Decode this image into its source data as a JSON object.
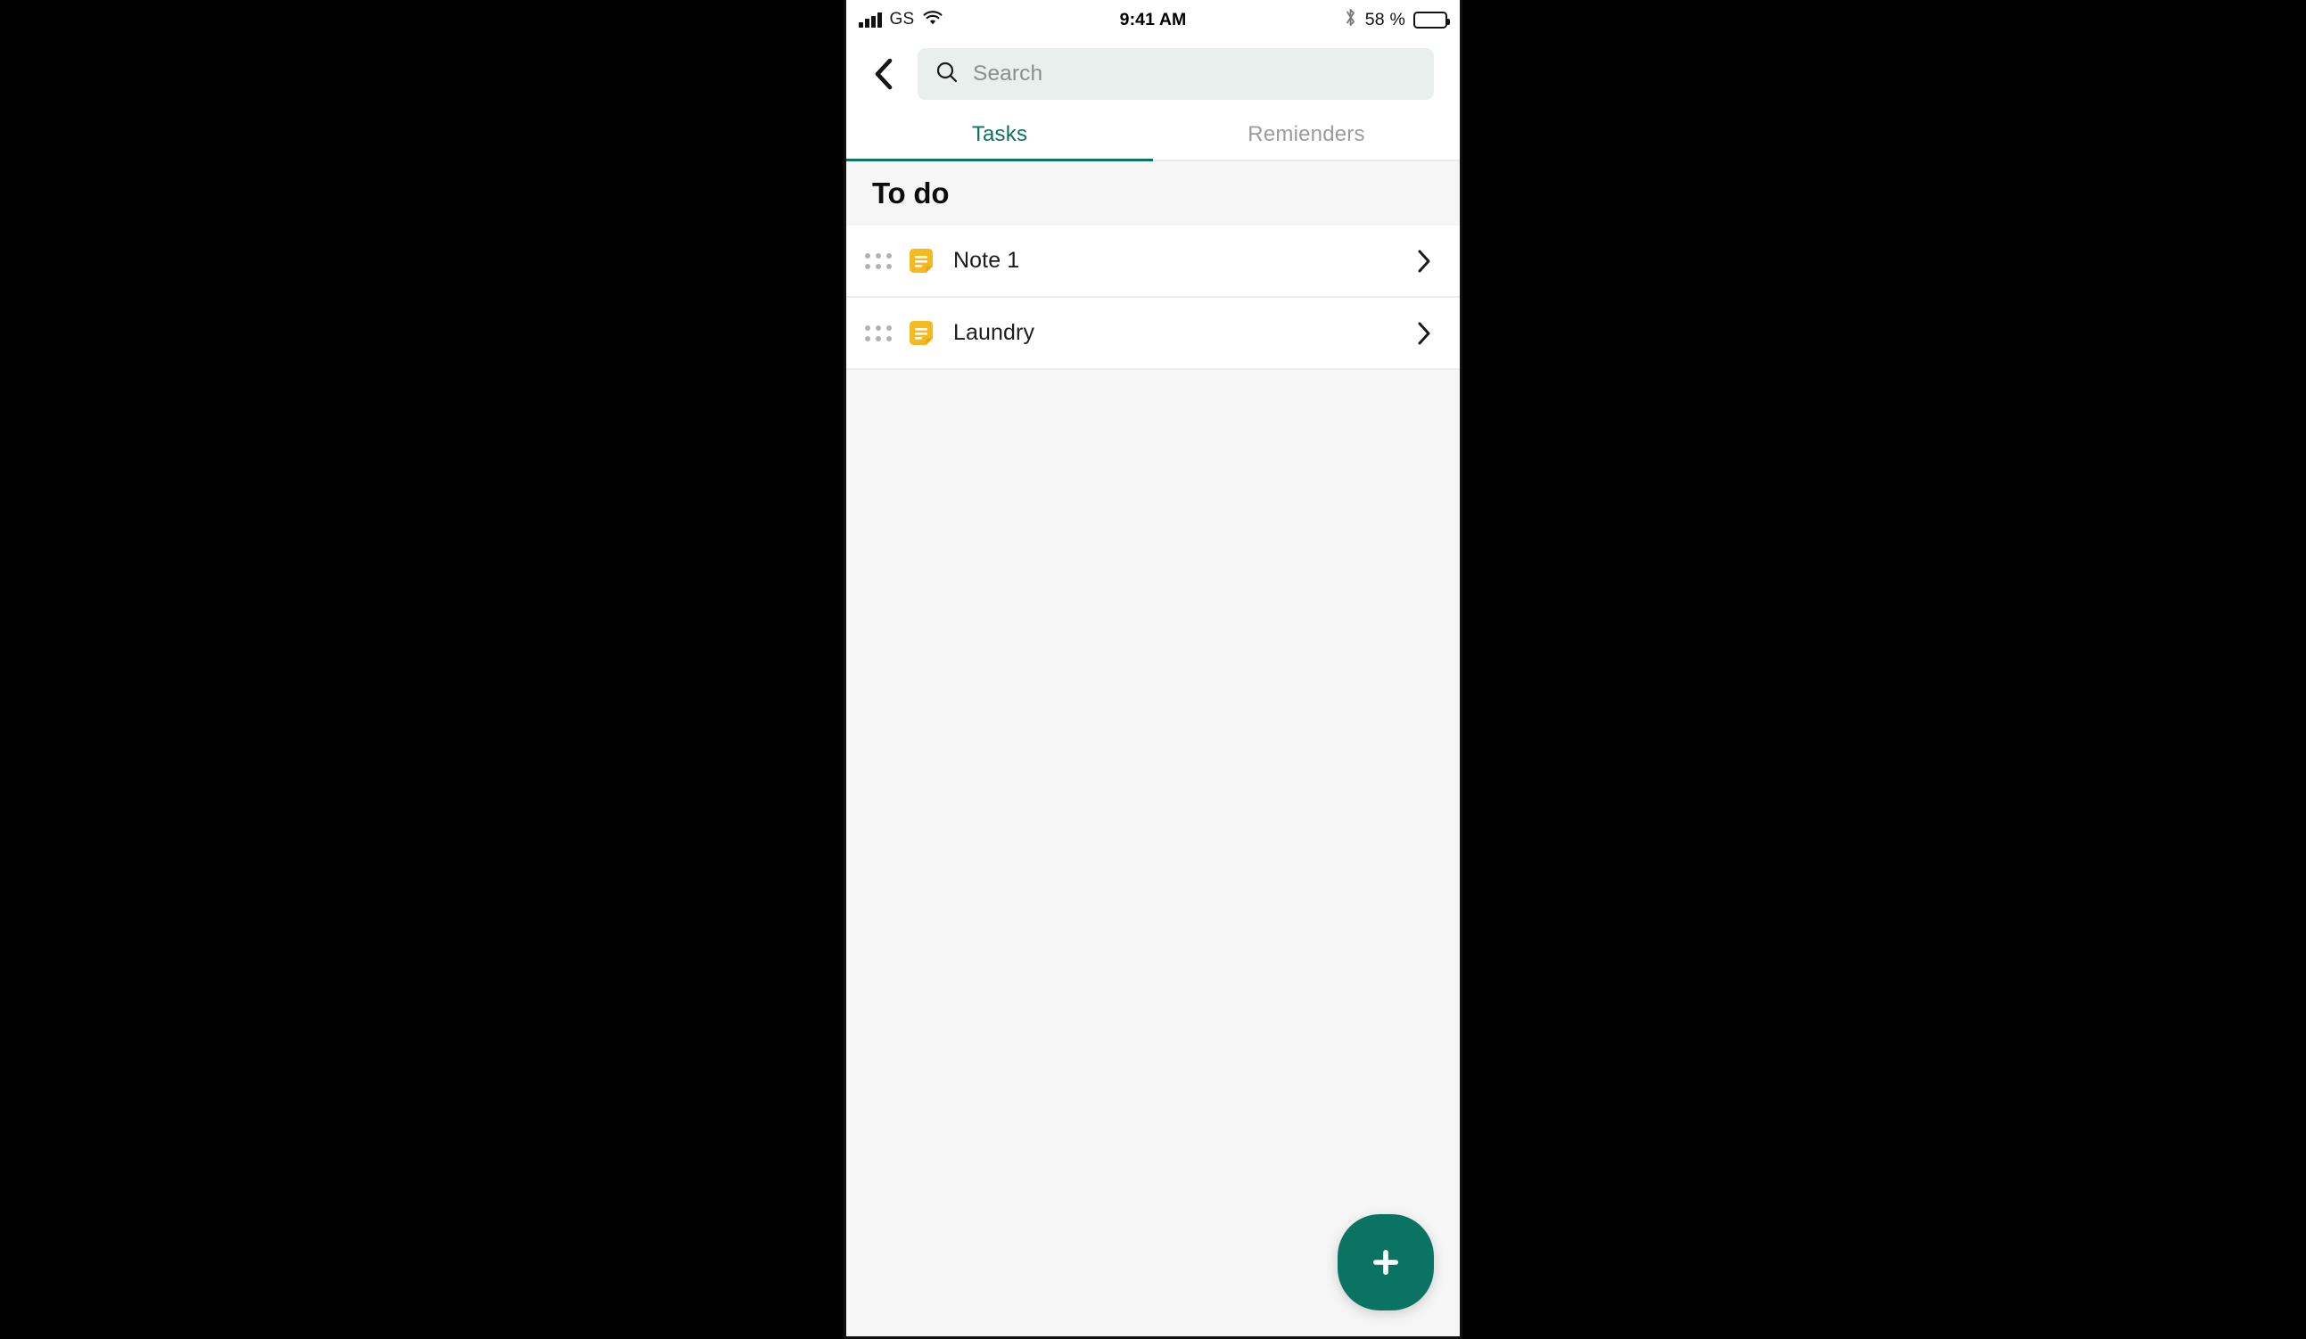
{
  "status_bar": {
    "signal_icon": "signal-bars-icon",
    "carrier": "GS",
    "wifi_icon": "wifi-icon",
    "time": "9:41 AM",
    "bluetooth_icon": "bluetooth-icon",
    "battery_percent": "58 %",
    "battery_level": 58,
    "battery_icon": "battery-icon"
  },
  "top_bar": {
    "back_icon": "chevron-left-icon",
    "search": {
      "icon": "search-icon",
      "placeholder": "Search",
      "value": ""
    }
  },
  "tabs": {
    "items": [
      {
        "label": "Tasks",
        "active": true
      },
      {
        "label": "Remienders",
        "active": false
      }
    ]
  },
  "content": {
    "section_title": "To do",
    "tasks": [
      {
        "drag_icon": "drag-handle-icon",
        "icon": "note-icon",
        "label": "Note 1",
        "chevron": "chevron-right-icon"
      },
      {
        "drag_icon": "drag-handle-icon",
        "icon": "note-icon",
        "label": "Laundry",
        "chevron": "chevron-right-icon"
      }
    ]
  },
  "fab": {
    "icon": "plus-icon",
    "label": "+"
  },
  "colors": {
    "accent": "#0b7361",
    "note_icon": "#f5b921",
    "search_bg": "#e8efec",
    "content_bg": "#f6f6f6",
    "inactive_tab": "#9b9b9b"
  }
}
